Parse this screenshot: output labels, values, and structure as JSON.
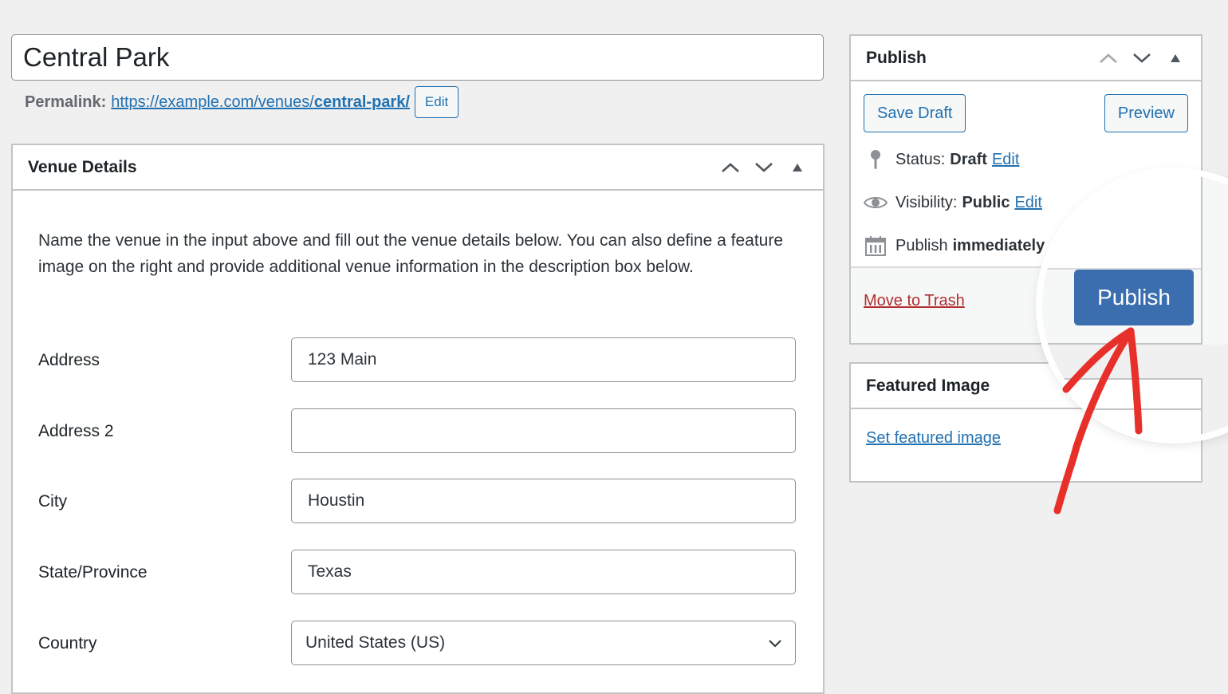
{
  "title": {
    "value": "Central Park"
  },
  "permalink": {
    "label": "Permalink:",
    "url_base": "https://example.com/venues/",
    "slug": "central-park/",
    "edit_label": "Edit"
  },
  "venue_details": {
    "heading": "Venue Details",
    "description": "Name the venue in the input above and fill out the venue details below. You can also define a feature image on the right and provide additional venue information in the description box below.",
    "fields": [
      {
        "label": "Address",
        "value": "123 Main"
      },
      {
        "label": "Address 2",
        "value": ""
      },
      {
        "label": "City",
        "value": "Houstin"
      },
      {
        "label": "State/Province",
        "value": "Texas"
      },
      {
        "label": "Country",
        "value": "United States (US)"
      }
    ]
  },
  "publish_box": {
    "heading": "Publish",
    "save_draft_label": "Save Draft",
    "preview_label": "Preview",
    "status": {
      "label": "Status:",
      "value": "Draft",
      "edit": "Edit"
    },
    "visibility": {
      "label": "Visibility:",
      "value": "Public",
      "edit": "Edit"
    },
    "schedule": {
      "label": "Publish",
      "value": "immediately"
    },
    "trash_label": "Move to Trash",
    "publish_label": "Publish"
  },
  "featured_image": {
    "heading": "Featured Image",
    "set_label": "Set featured image"
  },
  "colors": {
    "accent": "#2271b1",
    "primary_button": "#3a6eaf",
    "trash": "#b32d2e",
    "annotation_arrow": "#e8302a"
  }
}
